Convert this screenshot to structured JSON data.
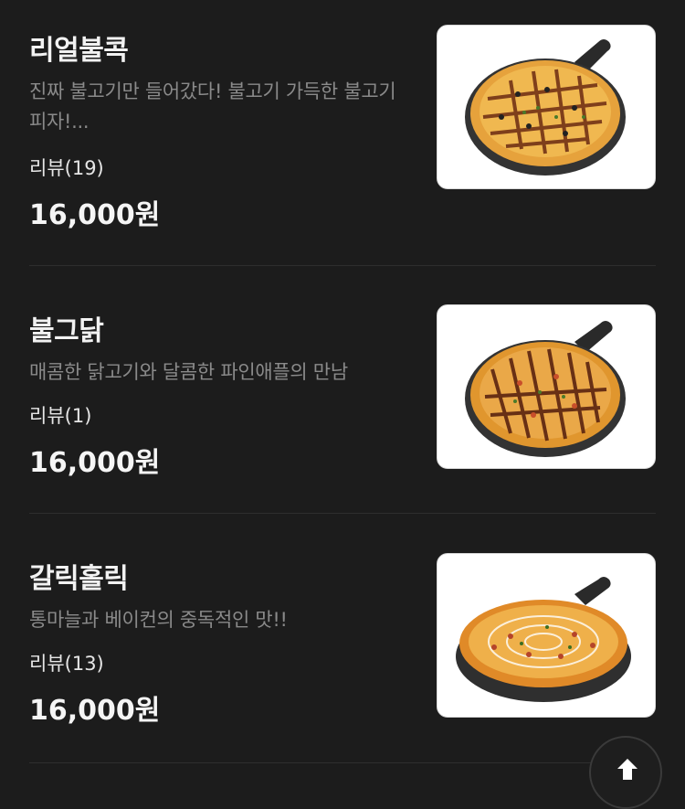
{
  "menu": {
    "items": [
      {
        "name": "리얼불콕",
        "description": "진짜 불고기만 들어갔다! 불고기 가득한 불고기 피자!...",
        "reviews": "리뷰(19)",
        "price": "16,000원",
        "image": "pizza-bulgogi-image"
      },
      {
        "name": "불그닭",
        "description": "매콤한 닭고기와 달콤한 파인애플의 만남",
        "reviews": "리뷰(1)",
        "price": "16,000원",
        "image": "pizza-chicken-image"
      },
      {
        "name": "갈릭홀릭",
        "description": "통마늘과 베이컨의 중독적인 맛!!",
        "reviews": "리뷰(13)",
        "price": "16,000원",
        "image": "pizza-garlic-image"
      }
    ]
  },
  "scroll_top": {
    "icon": "arrow-up-icon"
  },
  "colors": {
    "background": "#1c1c1c",
    "text_primary": "#f2f2f2",
    "text_secondary": "#8a8a8a",
    "divider": "#2e2e2e"
  }
}
